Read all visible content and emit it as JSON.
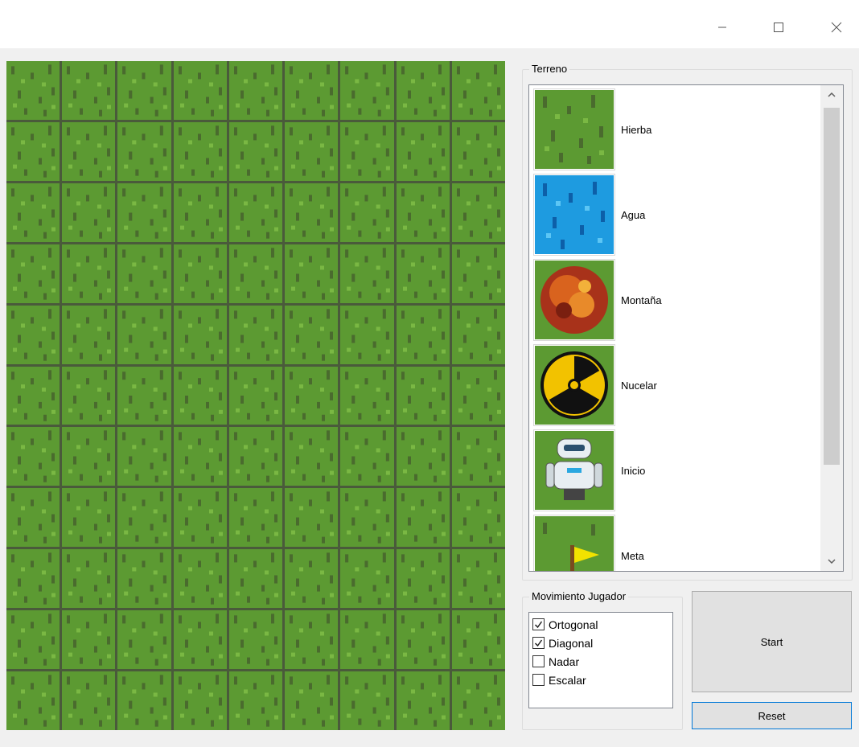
{
  "window": {
    "minimize_icon": "minimize-icon",
    "maximize_icon": "maximize-icon",
    "close_icon": "close-icon"
  },
  "map": {
    "columns": 9,
    "rows": 11,
    "tile": "grass"
  },
  "terrain": {
    "group_label": "Terreno",
    "items": [
      {
        "label": "Hierba",
        "icon": "grass-tile-icon"
      },
      {
        "label": "Agua",
        "icon": "water-tile-icon"
      },
      {
        "label": "Montaña",
        "icon": "lava-boulder-icon"
      },
      {
        "label": "Nucelar",
        "icon": "radiation-icon"
      },
      {
        "label": "Inicio",
        "icon": "robot-icon"
      },
      {
        "label": "Meta",
        "icon": "flag-icon"
      }
    ]
  },
  "movement": {
    "group_label": "Movimiento Jugador",
    "options": [
      {
        "label": "Ortogonal",
        "checked": true
      },
      {
        "label": "Diagonal",
        "checked": true
      },
      {
        "label": "Nadar",
        "checked": false
      },
      {
        "label": "Escalar",
        "checked": false
      }
    ]
  },
  "buttons": {
    "start_label": "Start",
    "reset_label": "Reset"
  }
}
